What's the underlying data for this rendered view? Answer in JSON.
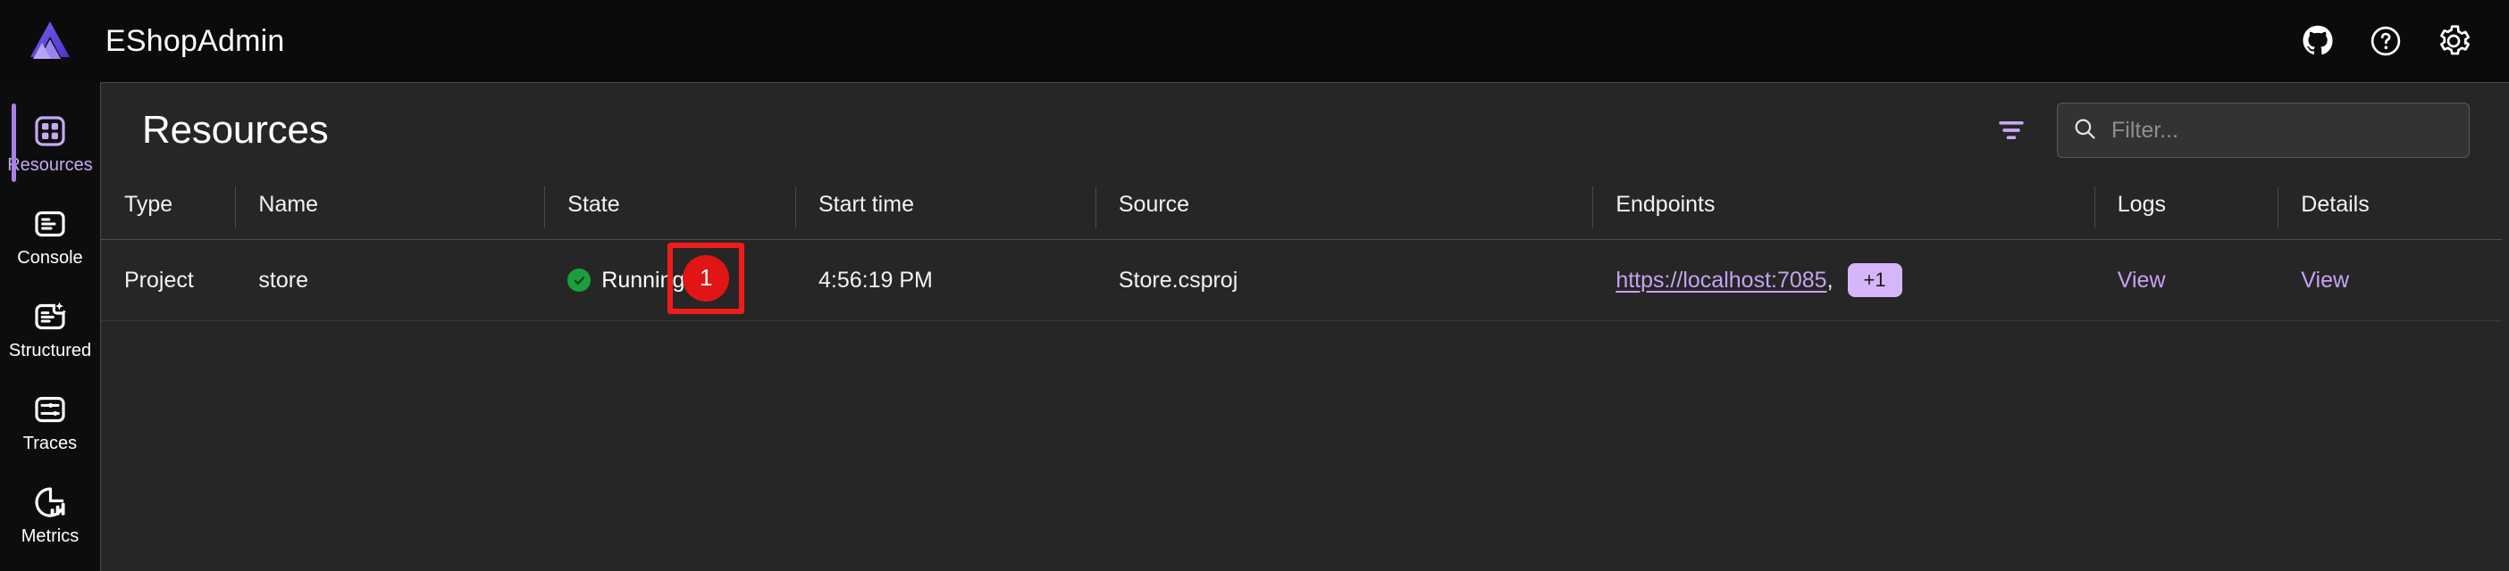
{
  "app": {
    "title": "EShopAdmin",
    "logo_icon": "aspire-logo-icon"
  },
  "topbar": {
    "actions": [
      {
        "name": "github-icon",
        "label": "GitHub"
      },
      {
        "name": "help-icon",
        "label": "Help"
      },
      {
        "name": "gear-icon",
        "label": "Settings"
      }
    ]
  },
  "sidebar": {
    "items": [
      {
        "label": "Resources",
        "icon": "grid-squares-icon",
        "active": true
      },
      {
        "label": "Console",
        "icon": "console-lines-icon",
        "active": false
      },
      {
        "label": "Structured",
        "icon": "structured-logs-icon",
        "active": false
      },
      {
        "label": "Traces",
        "icon": "traces-icon",
        "active": false
      },
      {
        "label": "Metrics",
        "icon": "metrics-pie-icon",
        "active": false
      }
    ]
  },
  "page": {
    "title": "Resources"
  },
  "toolbar": {
    "filter_icon": "filter-funnel-icon",
    "search_icon": "search-icon",
    "search_placeholder": "Filter...",
    "search_value": ""
  },
  "table": {
    "columns": [
      {
        "key": "type",
        "label": "Type"
      },
      {
        "key": "name",
        "label": "Name"
      },
      {
        "key": "state",
        "label": "State"
      },
      {
        "key": "start_time",
        "label": "Start time"
      },
      {
        "key": "source",
        "label": "Source"
      },
      {
        "key": "endpoints",
        "label": "Endpoints"
      },
      {
        "key": "logs",
        "label": "Logs"
      },
      {
        "key": "details",
        "label": "Details"
      }
    ],
    "rows": [
      {
        "type": "Project",
        "name": "store",
        "state": "Running",
        "state_icon": "check-circle-icon",
        "start_time": "4:56:19 PM",
        "source": "Store.csproj",
        "endpoint_url": "https://localhost:7085",
        "endpoint_separator": ",",
        "endpoint_more": "+1",
        "logs_label": "View",
        "details_label": "View"
      }
    ]
  },
  "annotation": {
    "badge_number": "1",
    "box_color": "#f01c1c",
    "badge_color": "#e11515"
  },
  "colors": {
    "accent_purple": "#a780e8",
    "link_purple": "#c6a2f0",
    "badge_purple": "#d6b6fb",
    "running_green": "#1a9e3e",
    "panel_bg": "#262626",
    "shell_bg": "#0d0d0d"
  }
}
